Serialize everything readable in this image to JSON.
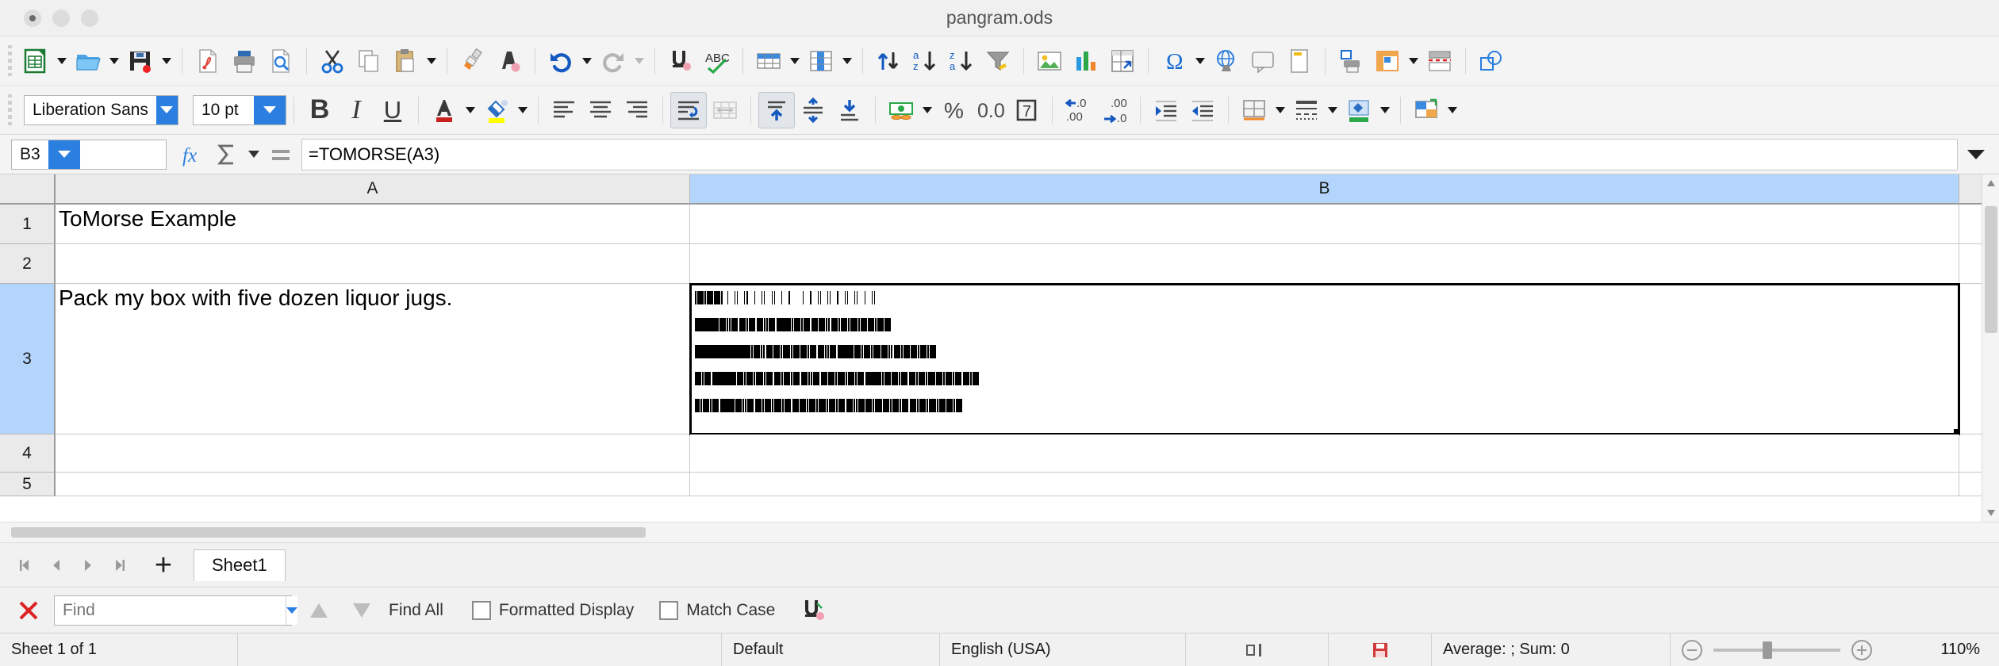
{
  "window": {
    "title": "pangram.ods",
    "traffic_lights": [
      "close",
      "minimize",
      "maximize"
    ]
  },
  "standard_toolbar": {
    "items": [
      {
        "name": "new-document-icon",
        "label": "New"
      },
      {
        "name": "new-dropdown-caret",
        "label": "New dropdown"
      },
      {
        "name": "open-file-icon",
        "label": "Open"
      },
      {
        "name": "open-dropdown-caret",
        "label": "Open dropdown"
      },
      {
        "name": "save-icon",
        "label": "Save"
      },
      {
        "name": "save-dropdown-caret",
        "label": "Save dropdown"
      },
      {
        "name": "export-pdf-icon",
        "label": "Export as PDF"
      },
      {
        "name": "print-icon",
        "label": "Print"
      },
      {
        "name": "print-preview-icon",
        "label": "Toggle Print Preview"
      },
      {
        "name": "cut-icon",
        "label": "Cut"
      },
      {
        "name": "copy-icon",
        "label": "Copy"
      },
      {
        "name": "paste-icon",
        "label": "Paste"
      },
      {
        "name": "paste-dropdown-caret",
        "label": "Paste dropdown"
      },
      {
        "name": "clone-formatting-icon",
        "label": "Clone Formatting"
      },
      {
        "name": "clear-formatting-icon",
        "label": "Clear Direct Formatting"
      },
      {
        "name": "undo-icon",
        "label": "Undo"
      },
      {
        "name": "undo-dropdown-caret",
        "label": "Undo dropdown"
      },
      {
        "name": "redo-icon",
        "label": "Redo"
      },
      {
        "name": "redo-dropdown-caret",
        "label": "Redo dropdown"
      },
      {
        "name": "find-replace-icon",
        "label": "Find and Replace"
      },
      {
        "name": "spelling-icon",
        "label": "Check Spelling"
      },
      {
        "name": "row-icon",
        "label": "Row"
      },
      {
        "name": "row-dropdown-caret",
        "label": "Row dropdown"
      },
      {
        "name": "column-icon",
        "label": "Column"
      },
      {
        "name": "column-dropdown-caret",
        "label": "Column dropdown"
      },
      {
        "name": "sort-icon",
        "label": "Sort"
      },
      {
        "name": "sort-ascending-icon",
        "label": "Sort Ascending"
      },
      {
        "name": "sort-descending-icon",
        "label": "Sort Descending"
      },
      {
        "name": "autofilter-icon",
        "label": "AutoFilter"
      },
      {
        "name": "insert-image-icon",
        "label": "Insert Image"
      },
      {
        "name": "insert-chart-icon",
        "label": "Insert Chart"
      },
      {
        "name": "pivot-table-icon",
        "label": "Insert Pivot Table"
      },
      {
        "name": "special-character-icon",
        "label": "Insert Special Character"
      },
      {
        "name": "special-character-dropdown-caret",
        "label": "Special character dropdown"
      },
      {
        "name": "hyperlink-icon",
        "label": "Insert Hyperlink"
      },
      {
        "name": "comment-icon",
        "label": "Insert Comment"
      },
      {
        "name": "headers-footers-icon",
        "label": "Headers and Footers"
      },
      {
        "name": "print-area-icon",
        "label": "Define Print Area"
      },
      {
        "name": "freeze-rows-columns-icon",
        "label": "Freeze Rows and Columns"
      },
      {
        "name": "freeze-dropdown-caret",
        "label": "Freeze dropdown"
      },
      {
        "name": "split-window-icon",
        "label": "Split Window"
      },
      {
        "name": "show-draw-functions-icon",
        "label": "Show Draw Functions"
      }
    ]
  },
  "formatting_toolbar": {
    "font_name": {
      "value": "Liberation Sans",
      "name": "font-name-combo"
    },
    "font_size": {
      "value": "10 pt",
      "name": "font-size-combo"
    },
    "items": [
      {
        "name": "bold-button",
        "label": "B",
        "active": false
      },
      {
        "name": "italic-button",
        "label": "I",
        "active": false
      },
      {
        "name": "underline-button",
        "label": "U",
        "active": false
      },
      {
        "name": "font-color-icon",
        "label": "Font Color",
        "color": "#c9211e"
      },
      {
        "name": "highlight-color-icon",
        "label": "Highlighting Color",
        "color": "#ffff00"
      },
      {
        "name": "align-left-icon",
        "label": "Align Left"
      },
      {
        "name": "align-center-icon",
        "label": "Align Center"
      },
      {
        "name": "align-right-icon",
        "label": "Align Right"
      },
      {
        "name": "wrap-text-icon",
        "label": "Wrap Text",
        "active": true
      },
      {
        "name": "merge-cells-icon",
        "label": "Merge Cells",
        "disabled": true
      },
      {
        "name": "align-top-icon",
        "label": "Align Top",
        "active": true
      },
      {
        "name": "center-vertically-icon",
        "label": "Center Vertically"
      },
      {
        "name": "align-bottom-icon",
        "label": "Align Bottom"
      },
      {
        "name": "currency-format-icon",
        "label": "Format as Currency"
      },
      {
        "name": "currency-dropdown-caret",
        "label": "Currency dropdown"
      },
      {
        "name": "percent-format-icon",
        "label": "Format as Percent"
      },
      {
        "name": "number-format-icon",
        "label": "Format as Number"
      },
      {
        "name": "date-format-icon",
        "label": "Format as Date"
      },
      {
        "name": "add-decimal-icon",
        "label": "Add Decimal Place"
      },
      {
        "name": "delete-decimal-icon",
        "label": "Delete Decimal Place"
      },
      {
        "name": "increase-indent-icon",
        "label": "Increase Indent"
      },
      {
        "name": "decrease-indent-icon",
        "label": "Decrease Indent"
      },
      {
        "name": "borders-icon",
        "label": "Borders"
      },
      {
        "name": "borders-dropdown-caret",
        "label": "Borders dropdown"
      },
      {
        "name": "border-style-icon",
        "label": "Border Style"
      },
      {
        "name": "border-style-dropdown-caret",
        "label": "Border style dropdown"
      },
      {
        "name": "background-color-icon",
        "label": "Background Color"
      },
      {
        "name": "background-color-dropdown-caret",
        "label": "Background color dropdown"
      },
      {
        "name": "conditional-formatting-icon",
        "label": "Conditional Formatting"
      },
      {
        "name": "conditional-dropdown-caret",
        "label": "Conditional dropdown"
      }
    ]
  },
  "formula_bar": {
    "name_box": "B3",
    "function_wizard_icon": "fx",
    "sum_icon": "sum",
    "formula_icon": "equals",
    "input_line": "=TOMORSE(A3)",
    "expand_caret": "chevron-down-icon"
  },
  "grid": {
    "column_headers": [
      "A",
      "B"
    ],
    "selected_column": "B",
    "row_headers": [
      "1",
      "2",
      "3",
      "4",
      "5"
    ],
    "selected_row": "3",
    "cells": {
      "A1": "ToMorse Example",
      "A2": "",
      "A3": "Pack my box with five dozen liquor jugs.",
      "B1": "",
      "B2": "",
      "B3": "morse-code-bars"
    },
    "active_cell": "B3"
  },
  "morse_output": {
    "description": "Morse code rendered as black bars for: Pack my box with five dozen liquor jugs.",
    "lines": [
      [
        2,
        1,
        8,
        1,
        2,
        1,
        8,
        1,
        8,
        1,
        2,
        6,
        1,
        8,
        1,
        2,
        1,
        8,
        1,
        2,
        2,
        8,
        1,
        8,
        1,
        2,
        1,
        9,
        1,
        2,
        1,
        8,
        1,
        8,
        2,
        16,
        1,
        8,
        2,
        8,
        1,
        2,
        1,
        8,
        1,
        2,
        1,
        8,
        2,
        8,
        1,
        2,
        1,
        8,
        1,
        2,
        1,
        9,
        1,
        8,
        1,
        2,
        1,
        8
      ],
      [
        30,
        1,
        8,
        1,
        2,
        1,
        2,
        1,
        8,
        2,
        8,
        1,
        2,
        1,
        8,
        2,
        8,
        1,
        2,
        1,
        2,
        1,
        8,
        2,
        18,
        1,
        2,
        1,
        8,
        1,
        2,
        1,
        8,
        2,
        8,
        1,
        8,
        1,
        2,
        1,
        2,
        2,
        8,
        1,
        2,
        1,
        8,
        1,
        2,
        1,
        9,
        1,
        2,
        1,
        8,
        1,
        8,
        1,
        2,
        1,
        8,
        1,
        8
      ],
      [
        70,
        1,
        2,
        1,
        8,
        1,
        2,
        1,
        2,
        2,
        8,
        1,
        8,
        1,
        2,
        1,
        9,
        1,
        2,
        1,
        8,
        1,
        8,
        1,
        2,
        1,
        8,
        2,
        8,
        1,
        2,
        1,
        2,
        1,
        8,
        2,
        20,
        1,
        8,
        1,
        2,
        1,
        8,
        1,
        2,
        1,
        9,
        1,
        8,
        1,
        2,
        1,
        2,
        2,
        8,
        1,
        2,
        1,
        8,
        1,
        8,
        1,
        2,
        1,
        8,
        1,
        2,
        1,
        8
      ],
      [
        8,
        1,
        2,
        1,
        8,
        2,
        30,
        1,
        8,
        1,
        2,
        1,
        8,
        1,
        2,
        1,
        9,
        1,
        2,
        1,
        8,
        2,
        8,
        1,
        2,
        1,
        8,
        1,
        2,
        1,
        8,
        2,
        8,
        1,
        2,
        1,
        2,
        1,
        8,
        2,
        8,
        1,
        8,
        1,
        2,
        1,
        9,
        1,
        2,
        1,
        8,
        1,
        2,
        1,
        8,
        2,
        20,
        1,
        2,
        1,
        8,
        1,
        8,
        1,
        2,
        1,
        8,
        2,
        8,
        1,
        2,
        1,
        8,
        1,
        2,
        1,
        9,
        1,
        8,
        1,
        2,
        1,
        8,
        1,
        2,
        1,
        8,
        2,
        8,
        1,
        2,
        1,
        8
      ],
      [
        6,
        1,
        2,
        1,
        8,
        1,
        2,
        1,
        8,
        2,
        18,
        1,
        8,
        1,
        2,
        1,
        2,
        1,
        8,
        2,
        8,
        1,
        2,
        1,
        8,
        1,
        2,
        1,
        9,
        1,
        2,
        1,
        8,
        2,
        8,
        1,
        8,
        1,
        2,
        1,
        8,
        1,
        2,
        1,
        9,
        1,
        2,
        1,
        8,
        1,
        2,
        1,
        8,
        2,
        8,
        1,
        2,
        1,
        2,
        1,
        8,
        1,
        8,
        1,
        2,
        1,
        9,
        1,
        8,
        1,
        2,
        1,
        8,
        1,
        2,
        1,
        8,
        2,
        8,
        1,
        2,
        1,
        8,
        1,
        2,
        1,
        9,
        1,
        2,
        1,
        8,
        1,
        8,
        1,
        2,
        1,
        8
      ]
    ]
  },
  "sheet_bar": {
    "first_sheet_icon": "first-sheet-icon",
    "previous_sheet_icon": "previous-sheet-icon",
    "next_sheet_icon": "next-sheet-icon",
    "last_sheet_icon": "last-sheet-icon",
    "add_sheet_icon": "plus-icon",
    "tabs": [
      {
        "label": "Sheet1",
        "active": true
      }
    ]
  },
  "find_bar": {
    "close_icon": "close-icon",
    "search_placeholder": "Find",
    "search_value": "",
    "find_previous_icon": "triangle-up-icon",
    "find_next_icon": "triangle-down-icon",
    "find_all_label": "Find All",
    "formatted_display_label": "Formatted Display",
    "formatted_display_checked": false,
    "match_case_label": "Match Case",
    "match_case_checked": false,
    "find_replace_icon": "find-and-replace-icon"
  },
  "status_bar": {
    "sheet_count": "Sheet 1 of 1",
    "page_style": "Default",
    "language": "English (USA)",
    "selection_mode_icon": "selection-mode-icon",
    "modified_icon": "document-modified-icon",
    "summary": "Average: ; Sum: 0",
    "zoom_out_icon": "zoom-out-icon",
    "zoom_in_icon": "zoom-in-icon",
    "zoom_level": "110%"
  }
}
